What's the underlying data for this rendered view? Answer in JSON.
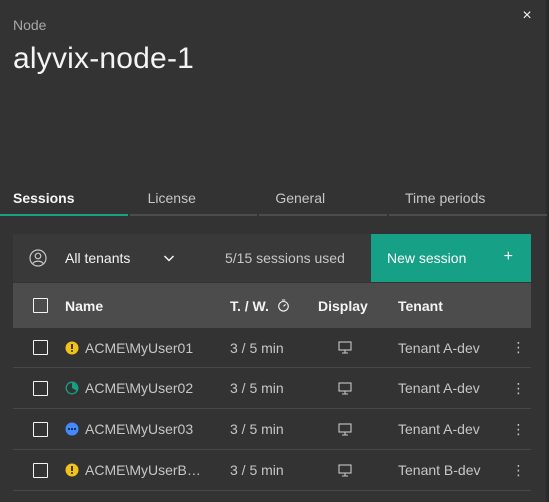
{
  "header": {
    "label": "Node",
    "title": "alyvix-node-1",
    "close_glyph": "×"
  },
  "tabs": [
    {
      "label": "Sessions",
      "selected": true
    },
    {
      "label": "License",
      "selected": false
    },
    {
      "label": "General",
      "selected": false
    },
    {
      "label": "Time periods",
      "selected": false
    }
  ],
  "toolbar": {
    "tenant_filter": "All tenants",
    "sessions_used": "5/15 sessions used",
    "new_session_label": "New session",
    "new_session_plus": "+"
  },
  "table": {
    "columns": {
      "name": "Name",
      "tw": "T. / W.",
      "display": "Display",
      "tenant": "Tenant"
    },
    "rows": [
      {
        "name": "ACME\\MyUser01",
        "status": "warning",
        "tw": "3 / 5 min",
        "tenant": "Tenant A-dev",
        "menu": "⋮"
      },
      {
        "name": "ACME\\MyUser02",
        "status": "progress",
        "tw": "3 / 5 min",
        "tenant": "Tenant A-dev",
        "menu": "⋮"
      },
      {
        "name": "ACME\\MyUser03",
        "status": "pending",
        "tw": "3 / 5 min",
        "tenant": "Tenant A-dev",
        "menu": "⋮"
      },
      {
        "name": "ACME\\MyUserB…",
        "status": "warning",
        "tw": "3 / 5 min",
        "tenant": "Tenant B-dev",
        "menu": "⋮"
      }
    ]
  },
  "colors": {
    "accent": "#16a085",
    "warning": "#f1c21b",
    "pending": "#4589ff",
    "background": "#333333"
  },
  "icons": {
    "close": "close-icon",
    "user": "user-avatar-icon",
    "chevron": "chevron-down-icon",
    "plus": "add-icon",
    "timer": "timer-icon",
    "monitor": "monitor-icon",
    "menu": "overflow-menu-icon"
  }
}
